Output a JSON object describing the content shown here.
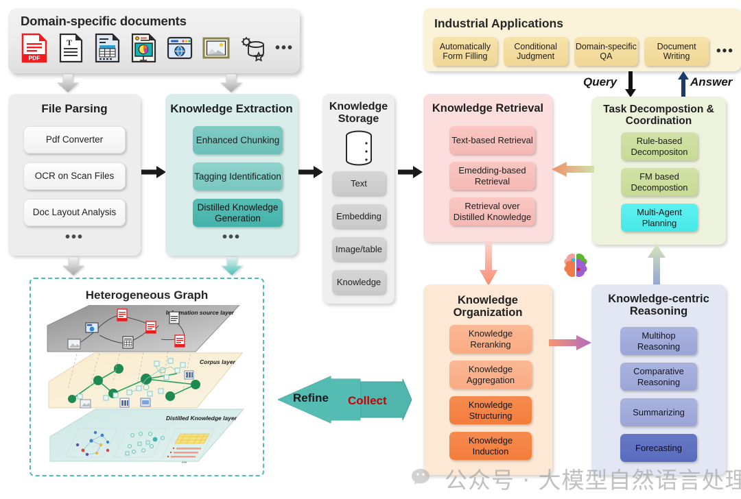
{
  "documents": {
    "title": "Domain-specific documents",
    "icons": [
      {
        "name": "pdf-file-icon",
        "label": "PDF"
      },
      {
        "name": "text-document-icon",
        "label": "T"
      },
      {
        "name": "spreadsheet-icon",
        "label": ""
      },
      {
        "name": "presentation-chart-icon",
        "label": ""
      },
      {
        "name": "web-page-icon",
        "label": ""
      },
      {
        "name": "image-file-icon",
        "label": ""
      },
      {
        "name": "database-settings-icon",
        "label": ""
      }
    ],
    "more": "•••"
  },
  "file_parsing": {
    "title": "File Parsing",
    "items": [
      "Pdf Converter",
      "OCR on Scan Files",
      "Doc Layout Analysis"
    ],
    "more": "•••"
  },
  "knowledge_extraction": {
    "title": "Knowledge Extraction",
    "items": [
      "Enhanced Chunking",
      "Tagging Identification",
      "Distilled Knowledge Generation"
    ],
    "more": "•••"
  },
  "knowledge_storage": {
    "title": "Knowledge Storage",
    "icon": "database-cylinder-icon",
    "items": [
      "Text",
      "Embedding",
      "Image/table",
      "Knowledge"
    ]
  },
  "knowledge_retrieval": {
    "title": "Knowledge Retrieval",
    "items": [
      "Text-based Retrieval",
      "Emedding-based Retrieval",
      "Retrieval over Distilled Knowledge"
    ]
  },
  "industrial_applications": {
    "title": "Industrial Applications",
    "items": [
      "Automatically Form Filling",
      "Conditional Judgment",
      "Domain-specific QA",
      "Document Writing"
    ],
    "more": "•••"
  },
  "task_decomposition": {
    "title": "Task Decompostion & Coordination",
    "items": [
      "Rule-based Decompositon",
      "FM based Decompostion",
      "Multi-Agent Planning"
    ]
  },
  "knowledge_organization": {
    "title": "Knowledge Organization",
    "items": [
      "Knowledge Reranking",
      "Knowledge Aggregation",
      "Knowledge Structuring",
      "Knowledge Induction"
    ]
  },
  "knowledge_reasoning": {
    "title": "Knowledge-centric Reasoning",
    "items": [
      "Multihop Reasoning",
      "Comparative Reasoning",
      "Summarizing",
      "Forecasting"
    ]
  },
  "heterogeneous_graph": {
    "title": "Heterogeneous Graph",
    "layers": [
      "Information source layer",
      "Corpus layer",
      "Distilled Knowledge layer"
    ]
  },
  "flow_labels": {
    "query": "Query",
    "answer": "Answer",
    "refine": "Refine",
    "collect": "Collect"
  },
  "watermark": {
    "text": "公众号 · 大模型自然语言处理",
    "icon": "wechat-icon"
  },
  "colors": {
    "teal": "#49bfb4",
    "pink": "#f5b9b4",
    "orange": "#f47d3c",
    "green": "#c8da96",
    "purple": "#5a6cbd",
    "yellow": "#f1d796",
    "cyan": "#48e8e8",
    "red": "#cc0000"
  }
}
